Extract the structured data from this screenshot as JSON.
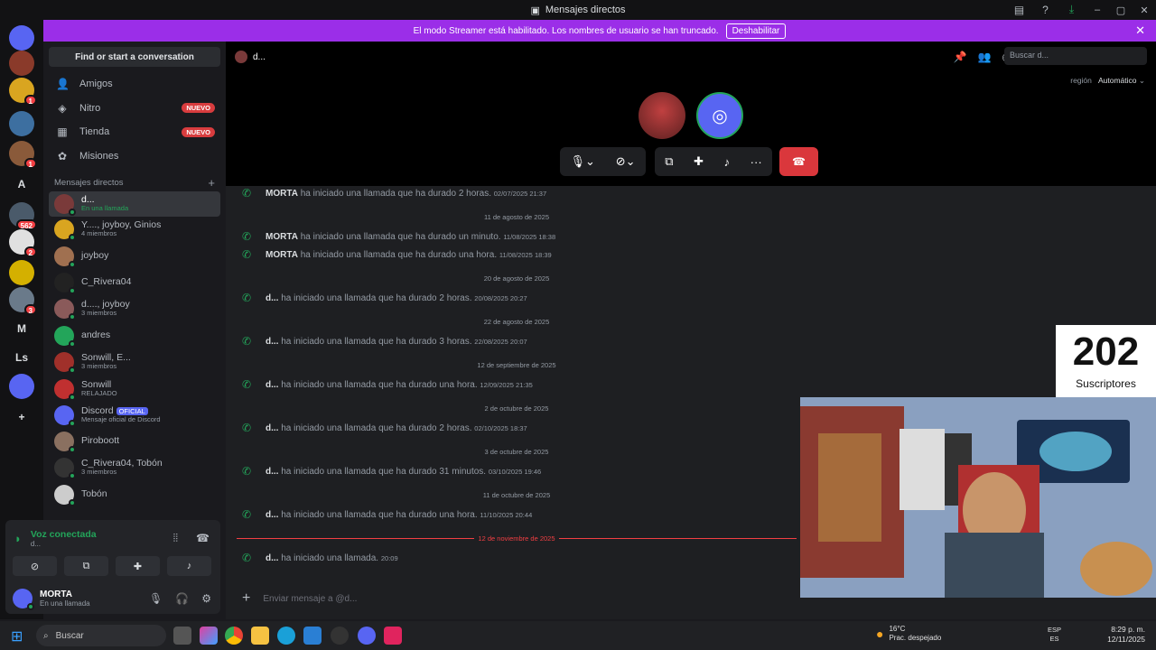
{
  "window": {
    "title": "Mensajes directos"
  },
  "banner": {
    "text": "El modo Streamer está habilitado. Los nombres de usuario se han truncado.",
    "button": "Deshabilitar"
  },
  "guilds": [
    {
      "label": "",
      "color": "#5865f2",
      "badge": ""
    },
    {
      "label": "",
      "color": "#8a3a2a",
      "badge": ""
    },
    {
      "label": "",
      "color": "#d9a520",
      "badge": "1"
    },
    {
      "label": "",
      "color": "#3d6fa0",
      "badge": ""
    },
    {
      "label": "",
      "color": "#8a5a3a",
      "badge": "1"
    },
    {
      "label": "A",
      "color": "#121214",
      "badge": ""
    },
    {
      "label": "",
      "color": "#4a5a6a",
      "badge": "562"
    },
    {
      "label": "",
      "color": "#e0e0e0",
      "badge": "2"
    },
    {
      "label": "",
      "color": "#d4b000",
      "badge": ""
    },
    {
      "label": "",
      "color": "#6a7a8a",
      "badge": "3"
    },
    {
      "label": "M",
      "color": "#121214",
      "badge": ""
    },
    {
      "label": "Ls",
      "color": "#121214",
      "badge": ""
    },
    {
      "label": "",
      "color": "#5865f2",
      "badge": ""
    },
    {
      "label": "+",
      "color": "#121214",
      "badge": ""
    },
    {
      "label": "",
      "color": "#121214",
      "badge": ""
    }
  ],
  "sidebar": {
    "find": "Find or start a conversation",
    "nav": [
      {
        "icon": "friends-icon",
        "label": "Amigos",
        "badge": ""
      },
      {
        "icon": "nitro-icon",
        "label": "Nitro",
        "badge": "NUEVO"
      },
      {
        "icon": "shop-icon",
        "label": "Tienda",
        "badge": "NUEVO"
      },
      {
        "icon": "quests-icon",
        "label": "Misiones",
        "badge": ""
      }
    ],
    "dm_header": "Mensajes directos",
    "dms": [
      {
        "name": "d...",
        "sub": "En una llamada",
        "color": "#7a3a3a",
        "active": true
      },
      {
        "name": "Y...., joyboy, Ginios",
        "sub": "4 miembros",
        "color": "#d9a520"
      },
      {
        "name": "joyboy",
        "sub": "",
        "color": "#a07050"
      },
      {
        "name": "C_Rivera04",
        "sub": "",
        "color": "#222"
      },
      {
        "name": "d...., joyboy",
        "sub": "3 miembros",
        "color": "#8a5a5a"
      },
      {
        "name": "andres",
        "sub": "",
        "color": "#23a55a"
      },
      {
        "name": "Sonwill, E...",
        "sub": "3 miembros",
        "color": "#a0302a"
      },
      {
        "name": "Sonwill",
        "sub": "RELAJADO",
        "color": "#c03030"
      },
      {
        "name": "Discord",
        "sub": "Mensaje oficial de Discord",
        "color": "#5865f2",
        "tag": "OFICIAL"
      },
      {
        "name": "Piroboott",
        "sub": "",
        "color": "#8a7060"
      },
      {
        "name": "C_Rivera04, Tobón",
        "sub": "3 miembros",
        "color": "#333"
      },
      {
        "name": "Tobón",
        "sub": "",
        "color": "#ccc"
      }
    ]
  },
  "voice": {
    "title": "Voz conectada",
    "sub": "d..."
  },
  "user": {
    "name": "MORTA",
    "sub": "En una llamada"
  },
  "call": {
    "name": "d...",
    "region_label": "región",
    "region_value": "Automático",
    "search_placeholder": "Buscar d..."
  },
  "messages": [
    {
      "type": "msg",
      "author": "MORTA",
      "text": "ha iniciado una llamada que ha durado 2 horas.",
      "ts": "02/07/2025 21:37"
    },
    {
      "type": "sep",
      "text": "11 de agosto de 2025"
    },
    {
      "type": "msg",
      "author": "MORTA",
      "text": "ha iniciado una llamada que ha durado un minuto.",
      "ts": "11/08/2025 18:38"
    },
    {
      "type": "msg",
      "author": "MORTA",
      "text": "ha iniciado una llamada que ha durado una hora.",
      "ts": "11/08/2025 18:39"
    },
    {
      "type": "sep",
      "text": "20 de agosto de 2025"
    },
    {
      "type": "msg",
      "author": "d...",
      "text": "ha iniciado una llamada que ha durado 2 horas.",
      "ts": "20/08/2025 20:27"
    },
    {
      "type": "sep",
      "text": "22 de agosto de 2025"
    },
    {
      "type": "msg",
      "author": "d...",
      "text": "ha iniciado una llamada que ha durado 3 horas.",
      "ts": "22/08/2025 20:07"
    },
    {
      "type": "sep",
      "text": "12 de septiembre de 2025"
    },
    {
      "type": "msg",
      "author": "d...",
      "text": "ha iniciado una llamada que ha durado una hora.",
      "ts": "12/09/2025 21:35"
    },
    {
      "type": "sep",
      "text": "2 de octubre de 2025"
    },
    {
      "type": "msg",
      "author": "d...",
      "text": "ha iniciado una llamada que ha durado 2 horas.",
      "ts": "02/10/2025 18:37"
    },
    {
      "type": "sep",
      "text": "3 de octubre de 2025"
    },
    {
      "type": "msg",
      "author": "d...",
      "text": "ha iniciado una llamada que ha durado 31 minutos.",
      "ts": "03/10/2025 19:46"
    },
    {
      "type": "sep",
      "text": "11 de octubre de 2025"
    },
    {
      "type": "msg",
      "author": "d...",
      "text": "ha iniciado una llamada que ha durado una hora.",
      "ts": "11/10/2025 20:44"
    },
    {
      "type": "sep",
      "text": "12 de noviembre de 2025",
      "new": true
    },
    {
      "type": "msg",
      "author": "d...",
      "text": "ha iniciado una llamada.",
      "ts": "20:09"
    }
  ],
  "input": {
    "placeholder": "Enviar mensaje a @d..."
  },
  "subs": {
    "count": "202",
    "label": "Suscriptores"
  },
  "taskbar": {
    "search": "Buscar",
    "temp": "16°C",
    "weather": "Prac. despejado",
    "lang1": "ESP",
    "lang2": "ES",
    "time": "8:29 p. m.",
    "date": "12/11/2025"
  }
}
